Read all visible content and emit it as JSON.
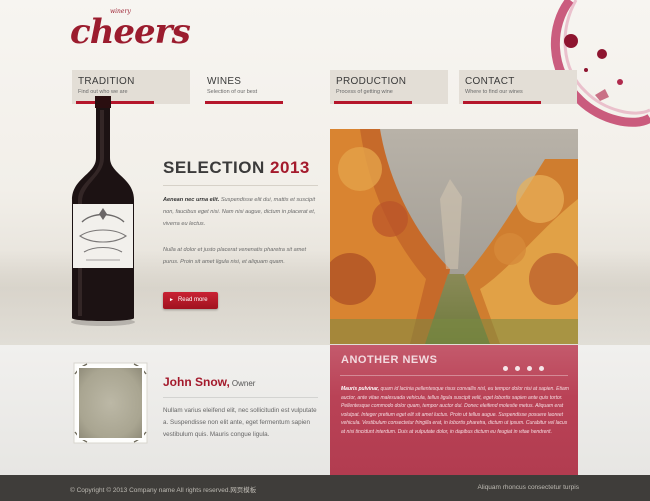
{
  "logo": {
    "text": "cheers",
    "tagline": "winery"
  },
  "nav": [
    {
      "title": "TRADITION",
      "subtitle": "Find out who we are"
    },
    {
      "title": "WINES",
      "subtitle": "Selection of our best"
    },
    {
      "title": "PRODUCTION",
      "subtitle": "Process of getting wine"
    },
    {
      "title": "CONTACT",
      "subtitle": "Where to find our wines"
    }
  ],
  "selection": {
    "title": "SELECTION",
    "year": "2013",
    "lead_bold": "Aenean nec urna elit.",
    "lead_rest": " Suspendisse elit dui, mattis et suscipit non, faucibus eget nisi. Nam nisi augue, dictum in placerat et, viverra eu lectus.",
    "paragraph": "Nulla at dolor et justo placerat venenatis pharetra sit amet purus. Proin sit amet ligula nisi, et aliquam quam.",
    "button": "Read more"
  },
  "person": {
    "name": "John Snow,",
    "role": "Owner",
    "text": "Nullam varius eleifend elit, nec sollicitudin est vulputate a. Suspendisse non elit ante, eget fermentum sapien vestibulum quis. Mauris congue ligula."
  },
  "news": {
    "title": "ANOTHER NEWS",
    "lead_bold": "Mauris pulvinar,",
    "text": " quam id lacinia pellentesque risus convallis nisl, eu tempor dolor nisi at sapien. Etiam auctor, ante vitae malesuada vehicula, tellus ligula suscipit velit, eget lobortis sapien ante quis tortor. Pellentesque commodo dolor quam, tempor auctor dui. Donec eleifend molestie metus. Aliquam erat volutpat. Integer pretium eget elit sit amet luctus. Proin ut tellus augue. Suspendisse posuere laoreet vehicula. Vestibulum consectetur fringilla erat, in lobortis pharetra, dictum ut ipsum. Curabitur vel lacus at nisi tincidunt interdum. Duis at vulputate dolor, in dapibus dictum eu feugiat in vitae hendrerit.",
    "dots": 4
  },
  "footer": {
    "copyright": "© Copyright © 2013 Company name All rights reserved.网页模板",
    "right": "Aliquam rhoncus consectetur turpis"
  },
  "colors": {
    "accent": "#a41a2c",
    "news_bg": "#b94256",
    "footer_bg": "#3f3d3a"
  }
}
